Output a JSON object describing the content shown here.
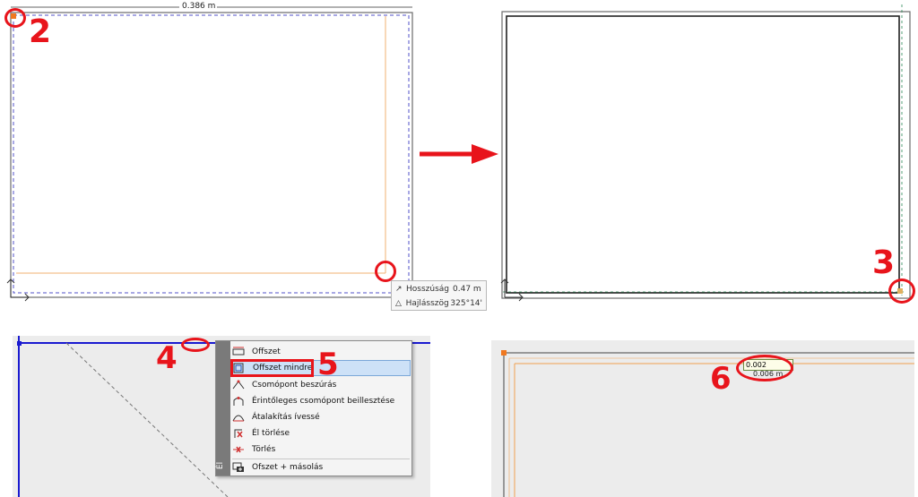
{
  "panel_top_left": {
    "dimension_label": "0.386 m",
    "step_label": "2"
  },
  "tooltip": {
    "rows": [
      {
        "icon": "length-icon",
        "label": "Hosszúság",
        "value": "0.47 m"
      },
      {
        "icon": "angle-icon",
        "label": "Hajlásszög",
        "value": "325°14'"
      }
    ]
  },
  "arrow": {
    "icon": "right-arrow-icon",
    "color": "#e8141b"
  },
  "panel_top_right": {
    "step_label": "3"
  },
  "context_menu": {
    "side_label": "Él",
    "step_click_label": "4",
    "step_menu_label": "5",
    "items": [
      {
        "label": "Offszet",
        "icon": "offset-icon"
      },
      {
        "label": "Offszet mindre",
        "icon": "offset-all-icon"
      },
      {
        "label": "Csomópont beszúrás",
        "icon": "insert-node-icon"
      },
      {
        "label": "Érintőleges csomópont beillesztése",
        "icon": "tangent-node-icon"
      },
      {
        "label": "Átalakítás ívessé",
        "icon": "convert-arc-icon"
      },
      {
        "label": "Él törlése",
        "icon": "delete-edge-icon"
      },
      {
        "label": "Törlés",
        "icon": "delete-icon"
      },
      {
        "label": "Ofszet + másolás",
        "icon": "offset-copy-icon"
      }
    ]
  },
  "panel_bottom_right": {
    "input_value": "0.002",
    "dimension_label": "0.006 m",
    "step_label": "6"
  },
  "colors": {
    "annotation": "#e8141b",
    "highlight": "#cde1f7",
    "guide_orange": "#f0a050",
    "guide_green": "#2e8b57",
    "guide_blue": "#4a4ad0"
  }
}
